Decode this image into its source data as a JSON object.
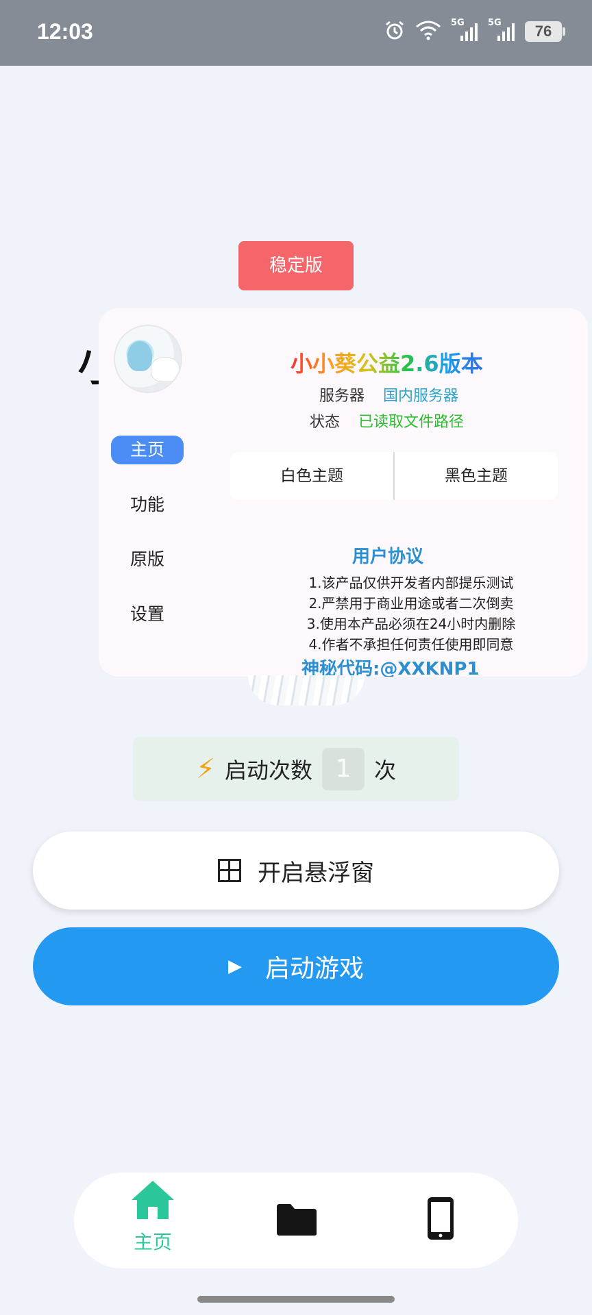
{
  "status_bar": {
    "time": "12:03",
    "signal_1": "5G",
    "signal_2": "5G",
    "battery": "76"
  },
  "badge": {
    "label": "稳定版"
  },
  "background_glyph": "小",
  "card": {
    "title": "小小葵公益2.6版本",
    "server_label": "服务器",
    "server_value": "国内服务器",
    "status_label": "状态",
    "status_value": "已读取文件路径",
    "nav": [
      {
        "label": "主页"
      },
      {
        "label": "功能"
      },
      {
        "label": "原版"
      },
      {
        "label": "设置"
      }
    ],
    "theme_light": "白色主题",
    "theme_dark": "黑色主题",
    "agreement_title": "用户协议",
    "agreement_items": [
      "1.该产品仅供开发者内部提乐测试",
      "2.严禁用于商业用途或者二次倒卖",
      "3.使用本产品必须在24小时内删除",
      "4.作者不承担任何责任使用即同意"
    ],
    "secret_code": "神秘代码:@XXKNP1"
  },
  "launch": {
    "label": "启动次数",
    "count": "1",
    "unit": "次"
  },
  "buttons": {
    "float_window": "开启悬浮窗",
    "start_game": "启动游戏"
  },
  "bottom_nav": {
    "home_label": "主页",
    "accent_color": "#2bc79a"
  },
  "colors": {
    "badge": "#f4666a",
    "primary_button": "#2499f1",
    "active_nav": "#4b8cf5"
  }
}
